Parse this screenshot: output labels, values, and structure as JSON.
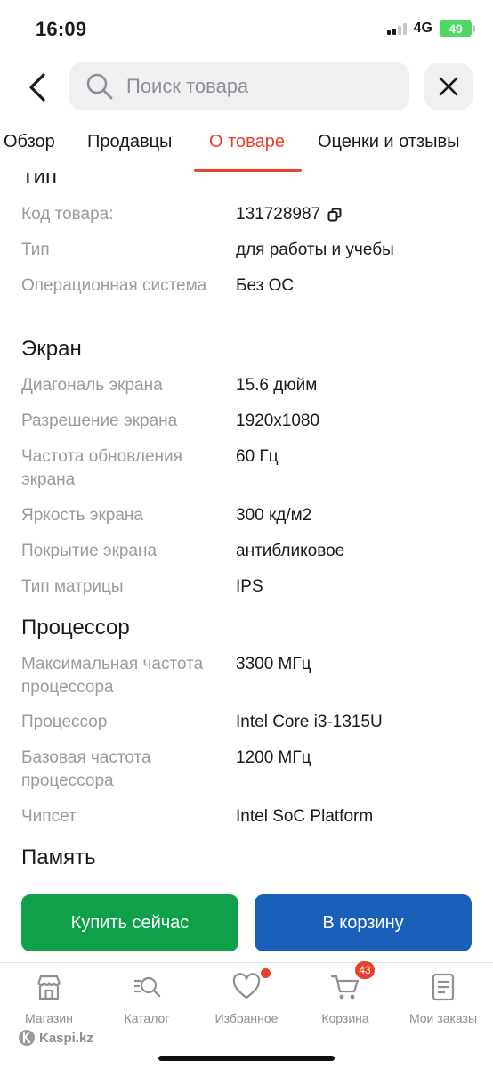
{
  "status_bar": {
    "time": "16:09",
    "network": "4G",
    "battery": "49"
  },
  "header": {
    "search_placeholder": "Поиск товара"
  },
  "tabs": [
    {
      "label": "Обзор",
      "active": false
    },
    {
      "label": "Продавцы",
      "active": false
    },
    {
      "label": "О товаре",
      "active": true
    },
    {
      "label": "Оценки и отзывы",
      "active": false
    }
  ],
  "spec": {
    "type_section": {
      "title": "Тип",
      "rows": [
        {
          "label": "Код товара:",
          "value": "131728987"
        },
        {
          "label": "Тип",
          "value": "для работы и учебы"
        },
        {
          "label": "Операционная система",
          "value": "Без ОС"
        }
      ]
    },
    "screen_section": {
      "title": "Экран",
      "rows": [
        {
          "label": "Диагональ экрана",
          "value": "15.6 дюйм"
        },
        {
          "label": "Разрешение экрана",
          "value": "1920x1080"
        },
        {
          "label": "Частота обновления экрана",
          "value": "60 Гц"
        },
        {
          "label": "Яркость экрана",
          "value": "300 кд/м2"
        },
        {
          "label": "Покрытие экрана",
          "value": "антибликовое"
        },
        {
          "label": "Тип матрицы",
          "value": "IPS"
        }
      ]
    },
    "cpu_section": {
      "title": "Процессор",
      "rows": [
        {
          "label": "Максимальная частота процессора",
          "value": "3300 МГц"
        },
        {
          "label": "Процессор",
          "value": "Intel Core i3-1315U"
        },
        {
          "label": "Базовая частота процессора",
          "value": "1200 МГц"
        },
        {
          "label": "Чипсет",
          "value": "Intel SoC Platform"
        }
      ]
    },
    "memory_section": {
      "title": "Память"
    }
  },
  "actions": {
    "buy_now": "Купить сейчас",
    "add_to_cart": "В корзину"
  },
  "bottom_nav": {
    "items": [
      {
        "label": "Магазин",
        "icon": "shop-icon"
      },
      {
        "label": "Каталог",
        "icon": "catalog-search-icon"
      },
      {
        "label": "Избранное",
        "icon": "heart-icon"
      },
      {
        "label": "Корзина",
        "icon": "cart-icon",
        "badge": "43"
      },
      {
        "label": "Мои заказы",
        "icon": "orders-icon"
      }
    ],
    "brand": "Kaspi.kz"
  },
  "colors": {
    "accent": "#e8402a",
    "buy_green": "#0fa14a",
    "cart_blue": "#1a5fb8",
    "label_gray": "#9a9aa0"
  }
}
